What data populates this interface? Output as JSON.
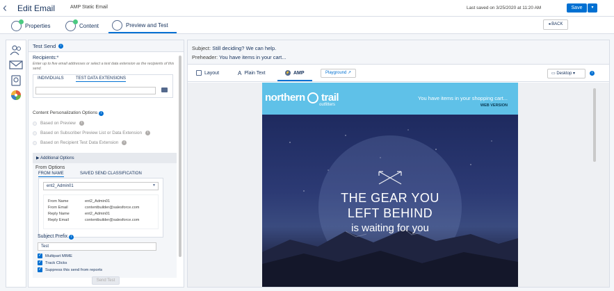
{
  "header": {
    "title": "Edit Email",
    "subtitle": "AMP Static Email",
    "last_saved": "Last saved on 3/25/2020 at 11:20 AM",
    "save_label": "Save",
    "caret": "▾"
  },
  "tabs": {
    "properties": "Properties",
    "content": "Content",
    "preview": "Preview and Test",
    "back_label": "◂ BACK"
  },
  "test_send": {
    "heading": "Test Send",
    "recipients_label": "Recipients:*",
    "recipients_help": "Enter up to five email addresses or select a test data extension as the recipients of this send.",
    "tab_individuals": "INDIVIDUALS",
    "tab_test_data": "TEST DATA EXTENSIONS",
    "personalization_label": "Content Personalization Options",
    "options": [
      "Based on Preview",
      "Based on Subscriber Preview List or Data Extension",
      "Based on Recipient Test Data Extension"
    ],
    "additional_options": "Additional Options",
    "from_options": "From Options",
    "tab_from_name": "FROM NAME",
    "tab_saved_send": "SAVED SEND CLASSIFICATION",
    "from_select": "ent2_Admin01",
    "details": [
      {
        "k": "From Name",
        "v": "ent2_Admin01"
      },
      {
        "k": "From Email",
        "v": "contentbuilder@salesforce.com"
      },
      {
        "k": "Reply Name",
        "v": "ent2_Admin01"
      },
      {
        "k": "Reply Email",
        "v": "contentbuilder@salesforce.com"
      }
    ],
    "subject_prefix_label": "Subject Prefix",
    "subject_prefix_value": "Test",
    "checkboxes": [
      "Multipart MIME",
      "Track Clicks",
      "Suppress this send from reports"
    ],
    "send_label": "Send Test"
  },
  "preview": {
    "subject_label": "Subject:",
    "subject_value": "Still deciding? We can help.",
    "preheader_label": "Preheader:",
    "preheader_value": "You have items in your cart...",
    "tab_layout": "Layout",
    "tab_plain": "Plain Text",
    "tab_amp": "AMP",
    "playground": "Playground",
    "device": "Desktop",
    "email": {
      "brand_a": "northern",
      "brand_b": "trail",
      "brand_sub": "outfitters",
      "cart_text": "You have items in your shopping cart...",
      "web_version": "WEB VERSION",
      "headline_1": "THE GEAR YOU",
      "headline_2": "LEFT BEHIND",
      "headline_3": "is waiting for you"
    }
  },
  "colors": {
    "accent": "#0070d2",
    "email_header": "#5fc1e8"
  }
}
